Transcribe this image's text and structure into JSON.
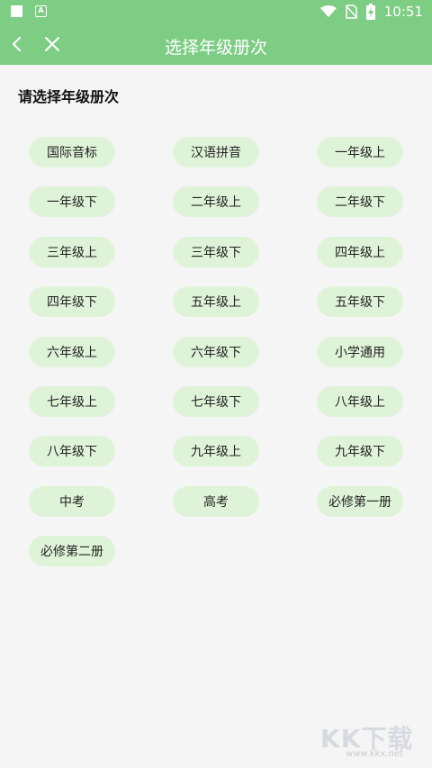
{
  "status_bar": {
    "time": "10:51",
    "icons": [
      "square-notification-icon",
      "a-notification-icon",
      "wifi-icon",
      "no-sim-icon",
      "battery-charging-icon"
    ]
  },
  "nav": {
    "title": "选择年级册次",
    "back_icon": "chevron-left-icon",
    "close_icon": "close-icon"
  },
  "heading": "请选择年级册次",
  "grades": [
    "国际音标",
    "汉语拼音",
    "一年级上",
    "一年级下",
    "二年级上",
    "二年级下",
    "三年级上",
    "三年级下",
    "四年级上",
    "四年级下",
    "五年级上",
    "五年级下",
    "六年级上",
    "六年级下",
    "小学通用",
    "七年级上",
    "七年级下",
    "八年级上",
    "八年级下",
    "九年级上",
    "九年级下",
    "中考",
    "高考",
    "必修第一册",
    "必修第二册"
  ],
  "watermark": {
    "text": "KK下载",
    "url": "www.kkx.net"
  },
  "colors": {
    "header": "#7ecd84",
    "chip": "#dff3d8",
    "background": "#f5f5f5"
  }
}
